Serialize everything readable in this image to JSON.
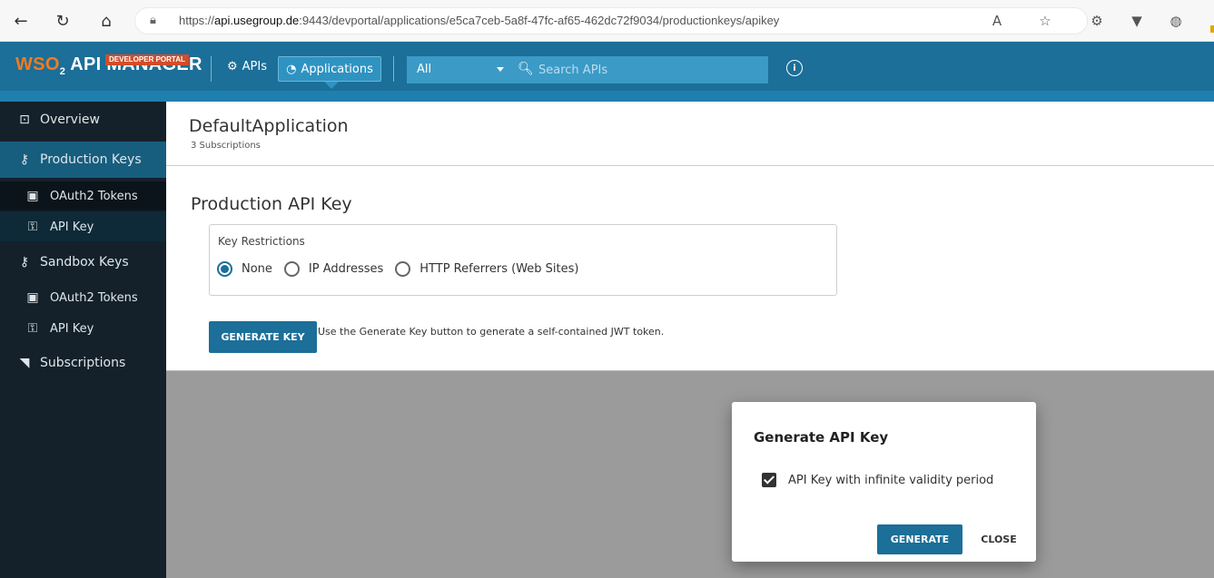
{
  "browser": {
    "url_prefix": "https://",
    "url_host": "api.usegroup.de",
    "url_rest": ":9443/devportal/applications/e5ca7ceb-5a8f-47fc-af65-462dc72f9034/productionkeys/apikey"
  },
  "header": {
    "logo_wso": "WSO",
    "logo_two": "2",
    "logo_text": "API MANAGER",
    "badge": "DEVELOPER PORTAL",
    "apis_label": "APIs",
    "applications_label": "Applications",
    "filter_value": "All",
    "search_placeholder": "Search APIs"
  },
  "sidebar": {
    "overview": "Overview",
    "production_keys": "Production Keys",
    "prod_oauth": "OAuth2 Tokens",
    "prod_apikey": "API Key",
    "sandbox_keys": "Sandbox Keys",
    "sand_oauth": "OAuth2 Tokens",
    "sand_apikey": "API Key",
    "subscriptions": "Subscriptions"
  },
  "main": {
    "app_name": "DefaultApplication",
    "subscriptions": "3 Subscriptions",
    "section_title": "Production API Key",
    "restrictions_label": "Key Restrictions",
    "opt_none": "None",
    "opt_ip": "IP Addresses",
    "opt_http": "HTTP Referrers (Web Sites)",
    "generate_key_label": "GENERATE KEY",
    "generate_hint": "Use the Generate Key button to generate a self-contained JWT token."
  },
  "dialog": {
    "title": "Generate API Key",
    "checkbox_label": "API Key with infinite validity period",
    "generate_label": "GENERATE",
    "close_label": "CLOSE"
  },
  "colors": {
    "header": "#1b6f98",
    "sidebar": "#14212b",
    "accent": "#1b6f98"
  }
}
